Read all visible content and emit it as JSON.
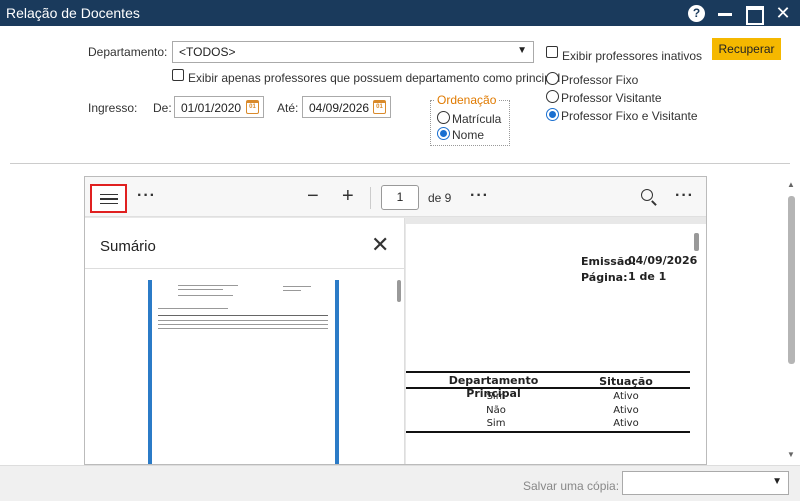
{
  "window": {
    "title": "Relação de Docentes",
    "help_glyph": "?",
    "close_glyph": "✕"
  },
  "filters": {
    "departamento_label": "Departamento:",
    "departamento_value": "<TODOS>",
    "only_principal_label": "Exibir apenas professores que possuem departamento como principal",
    "exibir_inativos_label": "Exibir professores inativos",
    "ingresso_label": "Ingresso:",
    "de_label": "De:",
    "de_value": "01/01/2020",
    "ate_label": "Até:",
    "ate_value": "04/09/2026",
    "calendar_glyph": "01"
  },
  "ordenacao": {
    "legend": "Ordenação",
    "options": [
      {
        "label": "Matrícula",
        "selected": false
      },
      {
        "label": "Nome",
        "selected": true
      }
    ]
  },
  "tipo_professor": {
    "options": [
      {
        "label": "Professor Fixo",
        "selected": false
      },
      {
        "label": "Professor Visitante",
        "selected": false
      },
      {
        "label": "Professor Fixo e Visitante",
        "selected": true
      }
    ]
  },
  "recuperar_label": "Recuperar",
  "viewer": {
    "more_glyph": "···",
    "zoom_out_glyph": "−",
    "zoom_in_glyph": "+",
    "page_current": "1",
    "page_total_label": "de 9",
    "toc_title": "Sumário",
    "toc_close_glyph": "✕"
  },
  "report": {
    "emissao_label": "Emissão:",
    "emissao_value": "04/09/2026",
    "pagina_label": "Página:",
    "pagina_value": "1 de 1",
    "columns": [
      "Departamento Principal",
      "Situação"
    ],
    "rows": [
      [
        "Sim",
        "Ativo"
      ],
      [
        "Não",
        "Ativo"
      ],
      [
        "Sim",
        "Ativo"
      ]
    ]
  },
  "footer": {
    "salvar_label": "Salvar uma cópia:",
    "salvar_value": ""
  },
  "colors": {
    "titlebar": "#1a3a5c",
    "accent": "#f5b800",
    "radio": "#1a6fd0",
    "ordenacao": "#e07a00"
  }
}
